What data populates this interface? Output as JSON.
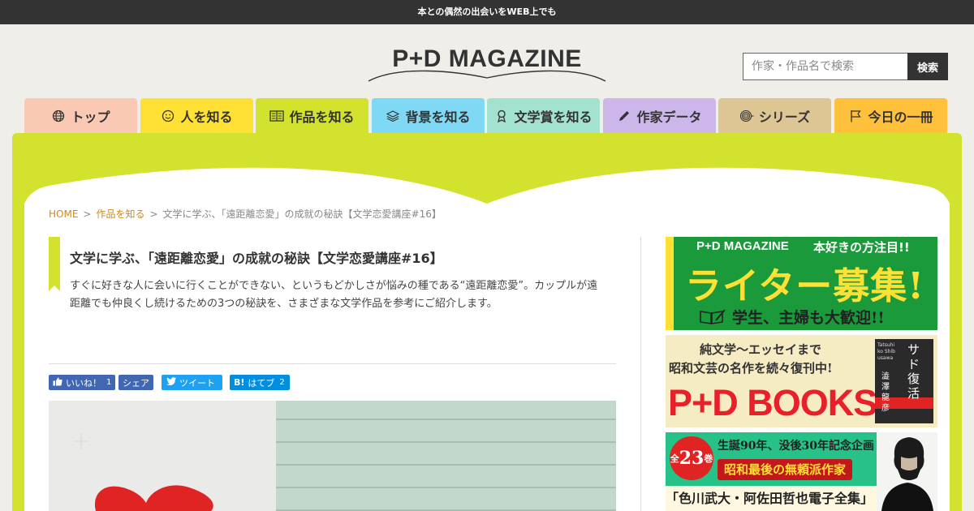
{
  "topbar": {
    "tagline": "本との偶然の出会いをWEB上でも"
  },
  "logo": {
    "text": "P+D MAGAZINE"
  },
  "search": {
    "placeholder": "作家・作品名で検索",
    "button_label": "検索"
  },
  "nav": {
    "tabs": [
      {
        "label": "トップ",
        "icon": "globe-icon",
        "color": "#f9c9b4"
      },
      {
        "label": "人を知る",
        "icon": "smiley-icon",
        "color": "#ffe135"
      },
      {
        "label": "作品を知る",
        "icon": "book-icon",
        "color": "#d2e22e",
        "active": true
      },
      {
        "label": "背景を知る",
        "icon": "layers-icon",
        "color": "#7fd9f5"
      },
      {
        "label": "文学賞を知る",
        "icon": "award-icon",
        "color": "#a3e2cf"
      },
      {
        "label": "作家データ",
        "icon": "pen-icon",
        "color": "#cdb7ea"
      },
      {
        "label": "シリーズ",
        "icon": "spiral-icon",
        "color": "#ddc594"
      },
      {
        "label": "今日の一冊",
        "icon": "flag-icon",
        "color": "#ffc13b"
      }
    ]
  },
  "breadcrumb": {
    "home": "HOME",
    "category": "作品を知る",
    "current": "文学に学ぶ、「遠距離恋愛」の成就の秘訣【文学恋愛講座#16】"
  },
  "article": {
    "title": "文学に学ぶ、「遠距離恋愛」の成就の秘訣【文学恋愛講座#16】",
    "lead": "すぐに好きな人に会いに行くことができない、というもどかしさが悩みの種である“遠距離恋愛”。カップルが遠距離でも仲良くし続けるための3つの秘訣を、さまざまな文学作品を参考にご紹介します。"
  },
  "share": {
    "like_label": "いいね！",
    "like_count": "1",
    "share_label": "シェア",
    "tweet_label": "ツイート",
    "hatena_logo": "B!",
    "hatena_label": "はてブ",
    "hatena_count": "2"
  },
  "banners": {
    "writer": {
      "brand": "P+D MAGAZINE",
      "tagline": "本好きの方注目!!",
      "headline": "ライター募集!",
      "sub": "学生、主婦も大歓迎!!"
    },
    "books": {
      "top": "純文学〜エッセイまで",
      "middle": "昭和文芸の名作を続々復刊中!",
      "logo": "P+D BOOKS",
      "cover_title": "サド復活",
      "cover_author": "澁澤龍彦",
      "cover_romaji": "Tatsuhiko Shibusawa"
    },
    "collection": {
      "volumes_prefix": "全",
      "volumes_num": "23",
      "volumes_suffix": "巻",
      "line1": "生誕90年、没後30年記念企画",
      "line2": "昭和最後の無頼派作家",
      "line3": "「色川武大・阿佐田哲也電子全集」"
    }
  },
  "colors": {
    "accent_green": "#d2e22e",
    "link_orange": "#d08a1b",
    "facebook": "#4267b2",
    "twitter": "#1da1f2",
    "hatena": "#008fde"
  }
}
